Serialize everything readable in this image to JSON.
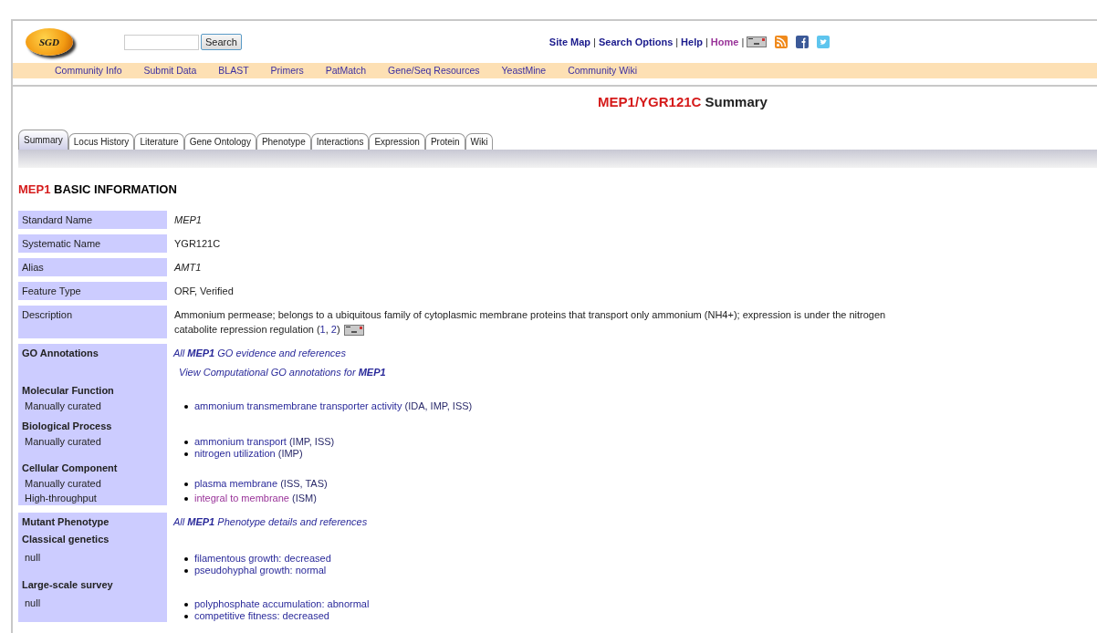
{
  "header": {
    "logo": "SGD",
    "search": {
      "button": "Search"
    },
    "links": [
      {
        "label": "Site Map",
        "visited": false
      },
      {
        "label": "Search Options",
        "visited": false
      },
      {
        "label": "Help",
        "visited": false
      },
      {
        "label": "Home",
        "visited": true
      }
    ],
    "separator": "|"
  },
  "nav": [
    "Community Info",
    "Submit Data",
    "BLAST",
    "Primers",
    "PatMatch",
    "Gene/Seq Resources",
    "YeastMine",
    "Community Wiki"
  ],
  "title": {
    "gene": "MEP1/YGR121C",
    "suffix": "Summary"
  },
  "tabs": [
    {
      "label": "Summary",
      "selected": true
    },
    {
      "label": "Locus History",
      "selected": false
    },
    {
      "label": "Literature",
      "selected": false
    },
    {
      "label": "Gene Ontology",
      "selected": false
    },
    {
      "label": "Phenotype",
      "selected": false
    },
    {
      "label": "Interactions",
      "selected": false
    },
    {
      "label": "Expression",
      "selected": false
    },
    {
      "label": "Protein",
      "selected": false
    },
    {
      "label": "Wiki",
      "selected": false
    }
  ],
  "section": {
    "gene": "MEP1",
    "label": "BASIC INFORMATION"
  },
  "basic_rows": [
    {
      "label": "Standard Name",
      "value": "MEP1",
      "italic": true
    },
    {
      "label": "Systematic Name",
      "value": "YGR121C",
      "italic": false
    },
    {
      "label": "Alias",
      "value": "AMT1",
      "italic": true
    },
    {
      "label": "Feature Type",
      "value": "ORF, Verified",
      "italic": false
    },
    {
      "label": "Description",
      "value": "Ammonium permease; belongs to a ubiquitous family of cytoplasmic membrane proteins that transport only ammonium (NH4+); expression is under the nitrogen catabolite repression regulation",
      "italic": false,
      "refs_open": "(",
      "refs": [
        "1",
        "2"
      ],
      "refs_sep": ",",
      "refs_close": ")"
    }
  ],
  "go": {
    "label": "GO Annotations",
    "link": "All **MEP1** GO evidence and references",
    "computational_link": "View Computational GO annotations for **MEP1**",
    "groups": [
      {
        "heading": "Molecular Function",
        "subgroups": [
          {
            "label": "Manually curated",
            "items": [
              {
                "term": "ammonium transmembrane transporter activity",
                "evidence": "(IDA, IMP, ISS)",
                "visited": false
              }
            ]
          }
        ]
      },
      {
        "heading": "Biological Process",
        "subgroups": [
          {
            "label": "Manually curated",
            "items": [
              {
                "term": "ammonium transport",
                "evidence": "(IMP, ISS)",
                "visited": false
              },
              {
                "term": "nitrogen utilization",
                "evidence": "(IMP)",
                "visited": false
              }
            ]
          }
        ]
      },
      {
        "heading": "Cellular Component",
        "subgroups": [
          {
            "label": "Manually curated",
            "items": [
              {
                "term": "plasma membrane",
                "evidence": "(ISS, TAS)",
                "visited": false
              }
            ]
          },
          {
            "label": "High-throughput",
            "items": [
              {
                "term": "integral to membrane",
                "evidence": "(ISM)",
                "visited": true
              }
            ]
          }
        ]
      }
    ]
  },
  "phenotype": {
    "label": "Mutant Phenotype",
    "link": "All **MEP1** Phenotype details and references",
    "groups": [
      {
        "heading": "Classical genetics",
        "subgroups": [
          {
            "label": "null",
            "items": [
              {
                "term": "filamentous growth: decreased",
                "visited": false
              },
              {
                "term": "pseudohyphal growth: normal",
                "visited": false
              }
            ]
          }
        ]
      },
      {
        "heading": "Large-scale survey",
        "subgroups": [
          {
            "label": "null",
            "items": [
              {
                "term": "polyphosphate accumulation: abnormal",
                "visited": false
              },
              {
                "term": "competitive fitness: decreased",
                "visited": false
              }
            ]
          }
        ]
      }
    ]
  }
}
